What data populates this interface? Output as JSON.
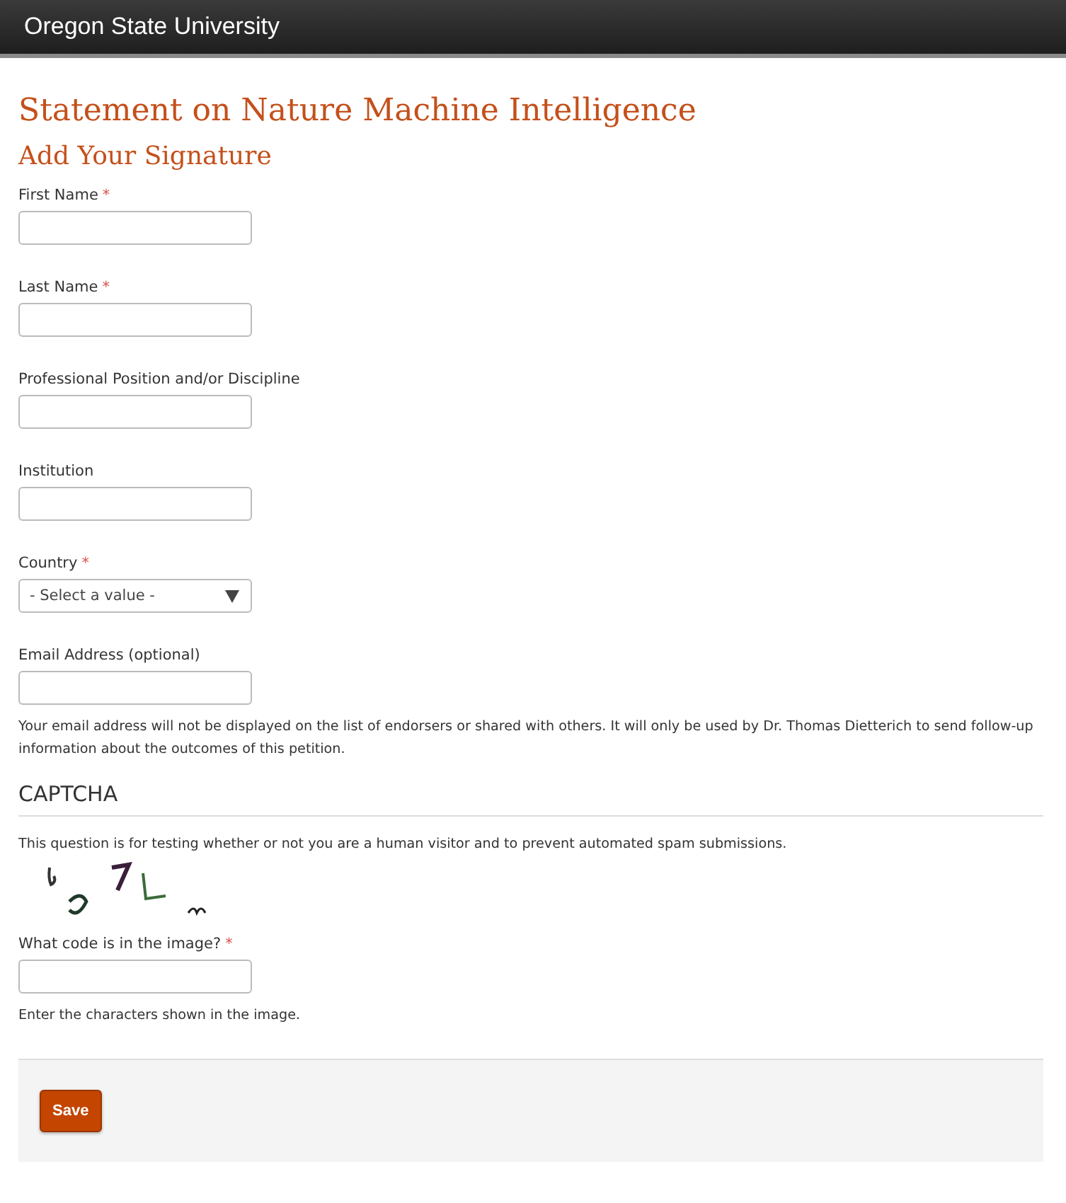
{
  "header": {
    "title": "Oregon State University"
  },
  "page_title": "Statement on Nature Machine Intelligence",
  "section_title": "Add Your Signature",
  "required_marker": "*",
  "fields": [
    {
      "kind": "text",
      "label": "First Name",
      "required": true
    },
    {
      "kind": "text",
      "label": "Last Name",
      "required": true
    },
    {
      "kind": "text",
      "label": "Professional Position and/or Discipline",
      "required": false
    },
    {
      "kind": "text",
      "label": "Institution",
      "required": false
    },
    {
      "kind": "select",
      "label": "Country",
      "required": true,
      "value": "- Select a value -"
    },
    {
      "kind": "text",
      "label": "Email Address (optional)",
      "required": false,
      "description": "Your email address will not be displayed on the list of endorsers or shared with others. It will only be used by Dr. Thomas Dietterich to send follow-up information about the outcomes of this petition."
    }
  ],
  "captcha": {
    "title": "CAPTCHA",
    "description": "This question is for testing whether or not you are a human visitor and to prevent automated spam submissions.",
    "label": "What code is in the image?",
    "required": true,
    "help": "Enter the characters shown in the image."
  },
  "actions": [
    {
      "label": "Save"
    }
  ]
}
